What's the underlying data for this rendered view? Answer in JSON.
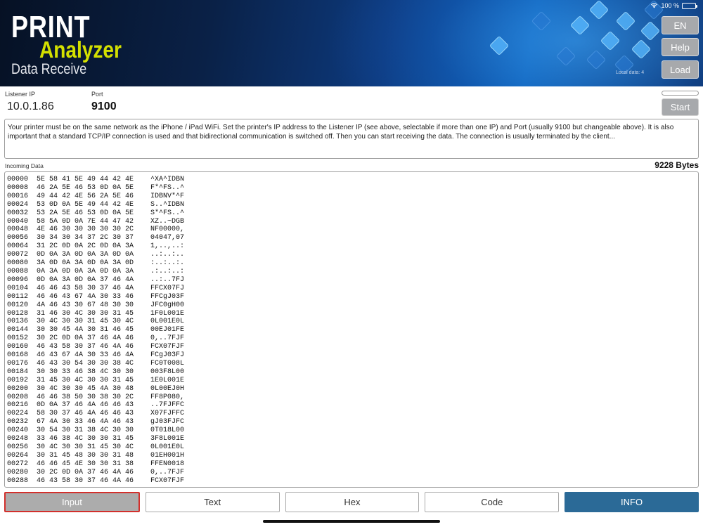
{
  "header": {
    "logo_print": "PRINT",
    "logo_analyzer": "Analyzer",
    "subtitle": "Data Receive",
    "local_data": "Local data: 4",
    "status_battery": "100 %",
    "buttons": {
      "lang": "EN",
      "help": "Help",
      "load": "Load"
    }
  },
  "listener": {
    "ip_label": "Listener IP",
    "ip_value": "10.0.1.86",
    "port_label": "Port",
    "port_value": "9100",
    "start_label": "Start"
  },
  "info_text": "Your printer must be on the same network as the iPhone / iPad WiFi. Set the printer's IP address to the Listener IP (see above, selectable if more than one IP) and Port (usually 9100 but changeable above). It is also important that a standard TCP/IP connection is used and that bidirectional communication is switched off. Then you can start receiving the data. The connection is usually terminated by the client...",
  "incoming": {
    "label": "Incoming Data",
    "byte_count": "9228 Bytes",
    "rows": [
      [
        "00000",
        "5E 58 41 5E 49 44 42 4E",
        "^XA^IDBN"
      ],
      [
        "00008",
        "46 2A 5E 46 53 0D 0A 5E",
        "F*^FS..^"
      ],
      [
        "00016",
        "49 44 42 4E 56 2A 5E 46",
        "IDBNV*^F"
      ],
      [
        "00024",
        "53 0D 0A 5E 49 44 42 4E",
        "S..^IDBN"
      ],
      [
        "00032",
        "53 2A 5E 46 53 0D 0A 5E",
        "S*^FS..^"
      ],
      [
        "00040",
        "58 5A 0D 0A 7E 44 47 42",
        "XZ..~DGB"
      ],
      [
        "00048",
        "4E 46 30 30 30 30 30 2C",
        "NF00000,"
      ],
      [
        "00056",
        "30 34 30 34 37 2C 30 37",
        "04047,07"
      ],
      [
        "00064",
        "31 2C 0D 0A 2C 0D 0A 3A",
        "1,..,..:"
      ],
      [
        "00072",
        "0D 0A 3A 0D 0A 3A 0D 0A",
        "..:..:.."
      ],
      [
        "00080",
        "3A 0D 0A 3A 0D 0A 3A 0D",
        ":..:..:."
      ],
      [
        "00088",
        "0A 3A 0D 0A 3A 0D 0A 3A",
        ".:..:..:"
      ],
      [
        "00096",
        "0D 0A 3A 0D 0A 37 46 4A",
        "..:..7FJ"
      ],
      [
        "00104",
        "46 46 43 58 30 37 46 4A",
        "FFCX07FJ"
      ],
      [
        "00112",
        "46 46 43 67 4A 30 33 46",
        "FFCgJ03F"
      ],
      [
        "00120",
        "4A 46 43 30 67 48 30 30",
        "JFC0gH00"
      ],
      [
        "00128",
        "31 46 30 4C 30 30 31 45",
        "1F0L001E"
      ],
      [
        "00136",
        "30 4C 30 30 31 45 30 4C",
        "0L001E0L"
      ],
      [
        "00144",
        "30 30 45 4A 30 31 46 45",
        "00EJ01FE"
      ],
      [
        "00152",
        "30 2C 0D 0A 37 46 4A 46",
        "0,..7FJF"
      ],
      [
        "00160",
        "46 43 58 30 37 46 4A 46",
        "FCX07FJF"
      ],
      [
        "00168",
        "46 43 67 4A 30 33 46 4A",
        "FCgJ03FJ"
      ],
      [
        "00176",
        "46 43 30 54 30 30 38 4C",
        "FC0T008L"
      ],
      [
        "00184",
        "30 30 33 46 38 4C 30 30",
        "003F8L00"
      ],
      [
        "00192",
        "31 45 30 4C 30 30 31 45",
        "1E0L001E"
      ],
      [
        "00200",
        "30 4C 30 30 45 4A 30 48",
        "0L00EJ0H"
      ],
      [
        "00208",
        "46 46 38 50 30 38 30 2C",
        "FF8P080,"
      ],
      [
        "00216",
        "0D 0A 37 46 4A 46 46 43",
        "..7FJFFC"
      ],
      [
        "00224",
        "58 30 37 46 4A 46 46 43",
        "X07FJFFC"
      ],
      [
        "00232",
        "67 4A 30 33 46 4A 46 43",
        "gJ03FJFC"
      ],
      [
        "00240",
        "30 54 30 31 38 4C 30 30",
        "0T018L00"
      ],
      [
        "00248",
        "33 46 38 4C 30 30 31 45",
        "3F8L001E"
      ],
      [
        "00256",
        "30 4C 30 30 31 45 30 4C",
        "0L001E0L"
      ],
      [
        "00264",
        "30 31 45 48 30 30 31 48",
        "01EH001H"
      ],
      [
        "00272",
        "46 46 45 4E 30 30 31 38",
        "FFEN0018"
      ],
      [
        "00280",
        "30 2C 0D 0A 37 46 4A 46",
        "0,..7FJF"
      ],
      [
        "00288",
        "46 43 58 30 37 46 4A 46",
        "FCX07FJF"
      ]
    ]
  },
  "tabs": {
    "input": "Input",
    "text": "Text",
    "hex": "Hex",
    "code": "Code",
    "info": "INFO"
  },
  "colors": {
    "accent_yellow": "#d4e000",
    "info_blue": "#2b6a97",
    "input_border": "#d2302c",
    "button_gray": "#a7a9ac"
  }
}
